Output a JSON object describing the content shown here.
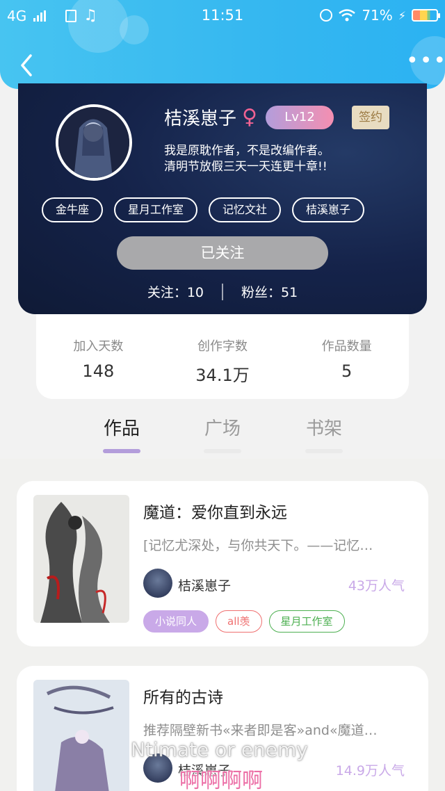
{
  "status": {
    "network": "4G",
    "time": "11:51",
    "battery": "71%"
  },
  "nav": {
    "more": "•••"
  },
  "profile": {
    "name": "桔溪崽子",
    "gender_symbol": "♀",
    "level": "Lv12",
    "signed": "签约",
    "bio_line1": "我是原耽作者，不是改编作者。",
    "bio_line2": "清明节放假三天一天连更十章!!",
    "tags": [
      "金牛座",
      "星月工作室",
      "记忆文社",
      "桔溪崽子"
    ],
    "follow_button": "已关注",
    "following_label": "关注：10",
    "followers_label": "粉丝：51"
  },
  "numbers": [
    {
      "label": "加入天数",
      "value": "148"
    },
    {
      "label": "创作字数",
      "value": "34.1万"
    },
    {
      "label": "作品数量",
      "value": "5"
    }
  ],
  "tabs": [
    {
      "label": "作品",
      "active": true
    },
    {
      "label": "广场",
      "active": false
    },
    {
      "label": "书架",
      "active": false
    }
  ],
  "works": [
    {
      "title": "魔道：爱你直到永远",
      "desc": "[记忆尤深处，与你共天下。——记忆…",
      "author": "桔溪崽子",
      "popularity": "43万人气",
      "tags": [
        "小说同人",
        "all羡",
        "星月工作室"
      ]
    },
    {
      "title": "所有的古诗",
      "desc": "推荐隔壁新书«来者即是客»and«魔道…",
      "author": "桔溪崽子",
      "popularity": "14.9万人气",
      "tags": []
    }
  ],
  "overlay": {
    "line1": "Ntimate or enemy",
    "line2": "啊啊啊啊"
  },
  "colors": {
    "topbar": "#35b7f0",
    "accent_purple": "#b39ddb",
    "popularity": "#c9a9e8"
  }
}
